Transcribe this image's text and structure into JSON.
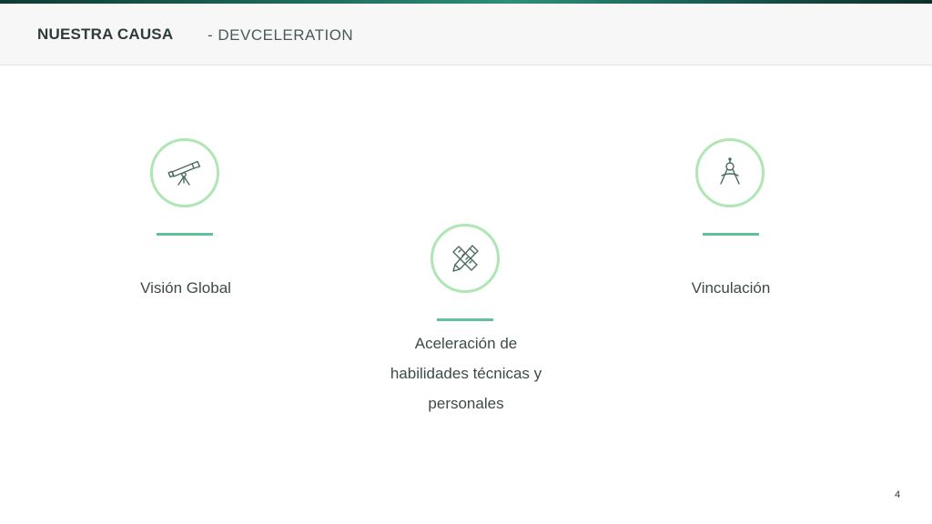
{
  "header": {
    "title": "NUESTRA CAUSA",
    "subtitle": "- DEVCELERATION"
  },
  "features": [
    {
      "label": "Visión Global",
      "icon": "telescope-icon"
    },
    {
      "label": "Aceleración de habilidades técnicas y personales",
      "icon": "pencil-ruler-icon"
    },
    {
      "label": "Vinculación",
      "icon": "compass-icon"
    }
  ],
  "page_number": "4",
  "colors": {
    "circle_border": "#aee6b4",
    "accent_bar": "#5fc29a",
    "icon_stroke": "#4a6b62"
  }
}
